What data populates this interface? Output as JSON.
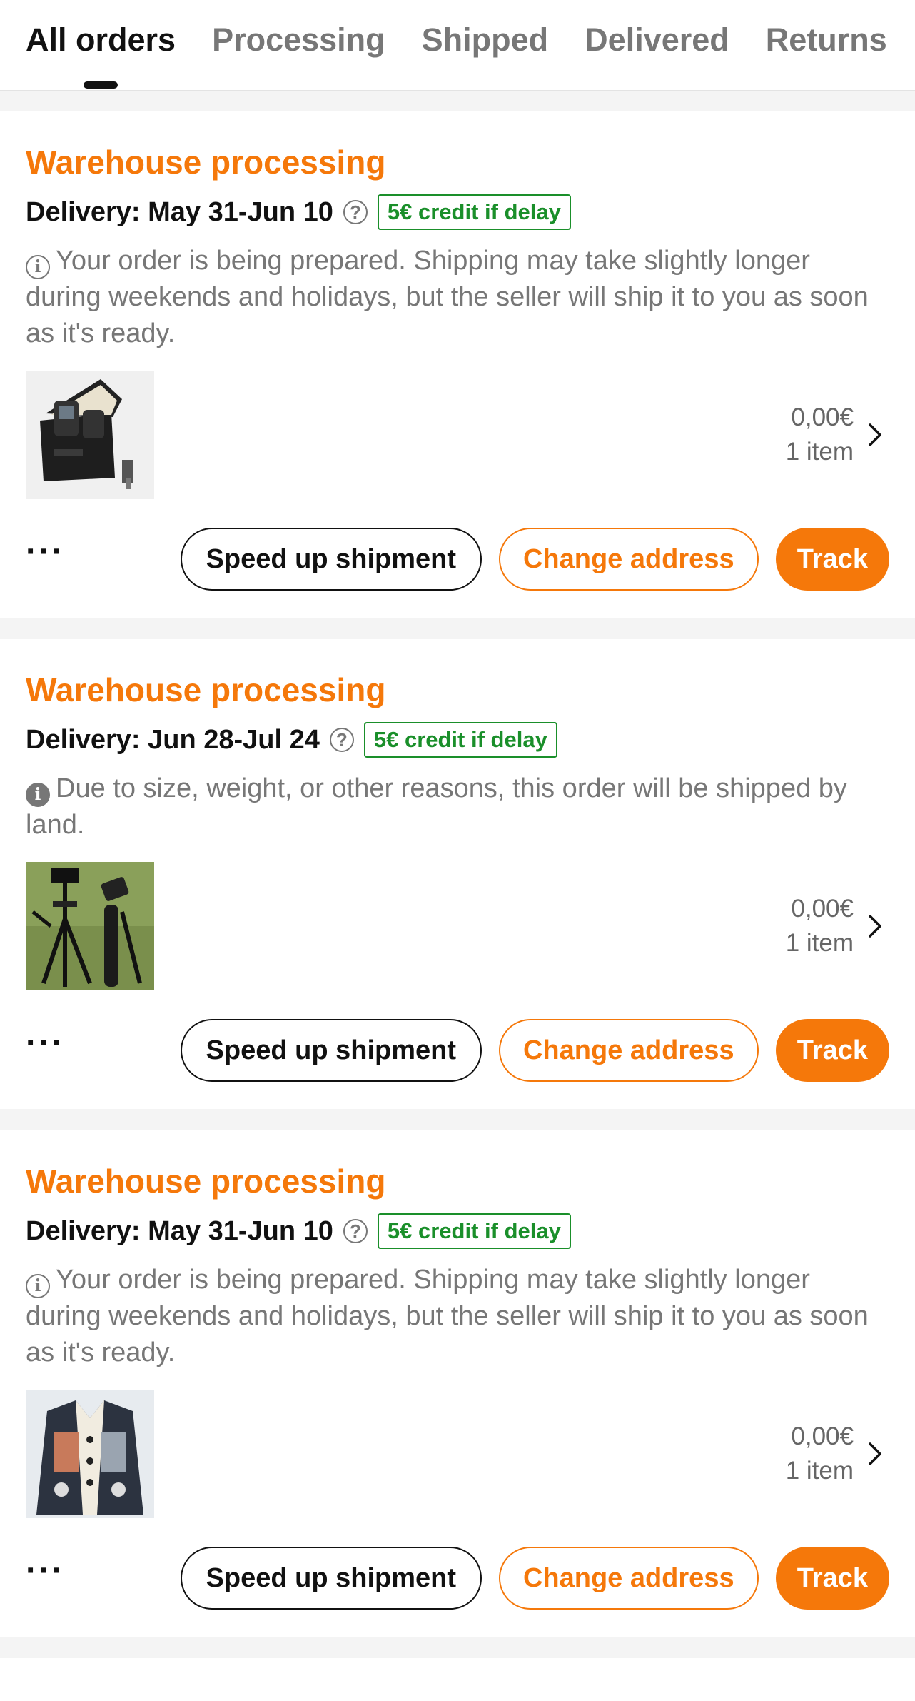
{
  "tabs": [
    "All orders",
    "Processing",
    "Shipped",
    "Delivered",
    "Returns"
  ],
  "active_tab": "All orders",
  "colors": {
    "accent": "#f5780a",
    "credit": "#1a8f2a",
    "muted": "#777777"
  },
  "orders": [
    {
      "status": "Warehouse processing",
      "delivery": "Delivery: May 31-Jun 10",
      "credit": "5€ credit if delay",
      "note": "Your order is being prepared. Shipping may take slightly longer during weekends and holidays, but the seller will ship it to you as soon as it's ready.",
      "note_icon": "info-outline-icon",
      "price": "0,00€",
      "items": "1 item",
      "image": "wireless-microphone-case",
      "more": "···",
      "btn_speed": "Speed up shipment",
      "btn_address": "Change address",
      "btn_track": "Track"
    },
    {
      "status": "Warehouse processing",
      "delivery": "Delivery: Jun 28-Jul 24",
      "credit": "5€ credit if delay",
      "note": "Due to size, weight, or other reasons, this order will be shipped by land.",
      "note_icon": "info-filled-icon",
      "price": "0,00€",
      "items": "1 item",
      "image": "camera-tripod",
      "more": "···",
      "btn_speed": "Speed up shipment",
      "btn_address": "Change address",
      "btn_track": "Track"
    },
    {
      "status": "Warehouse processing",
      "delivery": "Delivery: May 31-Jun 10",
      "credit": "5€ credit if delay",
      "note": "Your order is being prepared. Shipping may take slightly longer during weekends and holidays, but the seller will ship it to you as soon as it's ready.",
      "note_icon": "info-outline-icon",
      "price": "0,00€",
      "items": "1 item",
      "image": "patterned-knit-cardigan",
      "more": "···",
      "btn_speed": "Speed up shipment",
      "btn_address": "Change address",
      "btn_track": "Track"
    }
  ]
}
